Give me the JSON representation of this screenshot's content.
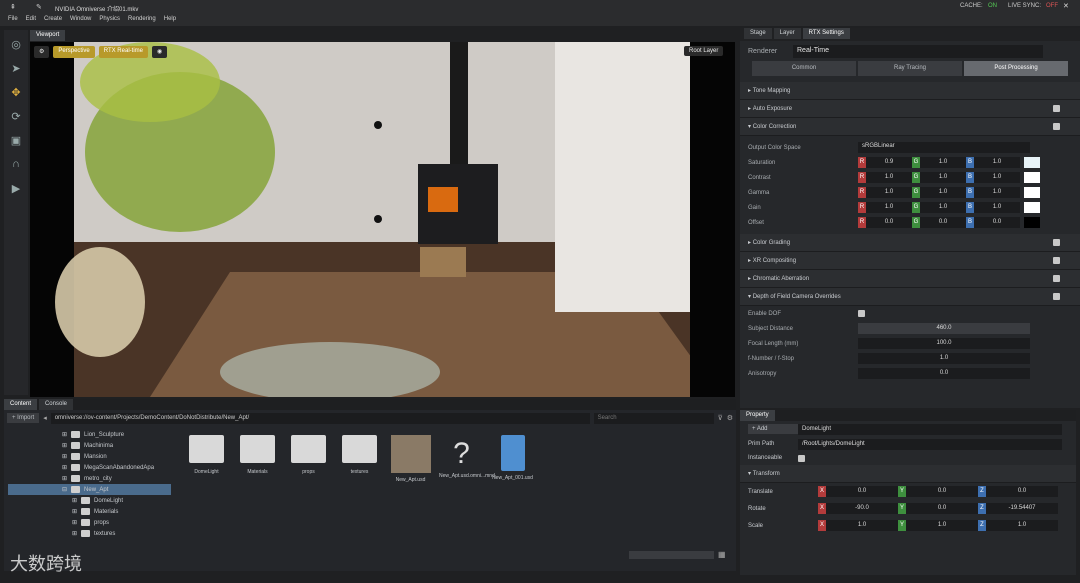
{
  "window": {
    "title": "NVIDIA Omniverse 介绍01.mkv",
    "cache": "CACHE:",
    "cache_state": "ON",
    "live_sync": "LIVE SYNC:",
    "live_state": "OFF"
  },
  "menu": [
    "File",
    "Edit",
    "Create",
    "Window",
    "Physics",
    "Rendering",
    "Help"
  ],
  "viewport": {
    "tab": "Viewport",
    "camera": "Perspective",
    "render": "RTX Real-time",
    "layer": "Root Layer"
  },
  "right_tabs": [
    "Stage",
    "Layer",
    "RTX Settings"
  ],
  "renderer": {
    "label": "Renderer",
    "value": "Real-Time",
    "tabs": [
      "Common",
      "Ray Tracing",
      "Post Processing"
    ]
  },
  "sections": [
    "Tone Mapping",
    "Auto Exposure",
    "Color Correction",
    "Color Grading",
    "XR Compositing",
    "Chromatic Aberration",
    "Depth of Field Camera Overrides"
  ],
  "color_correction": {
    "space_label": "Output Color Space",
    "space_value": "sRGBLinear",
    "rows": [
      {
        "label": "Saturation",
        "r": "0.9",
        "g": "1.0",
        "b": "1.0"
      },
      {
        "label": "Contrast",
        "r": "1.0",
        "g": "1.0",
        "b": "1.0"
      },
      {
        "label": "Gamma",
        "r": "1.0",
        "g": "1.0",
        "b": "1.0"
      },
      {
        "label": "Gain",
        "r": "1.0",
        "g": "1.0",
        "b": "1.0"
      },
      {
        "label": "Offset",
        "r": "0.0",
        "g": "0.0",
        "b": "0.0"
      }
    ]
  },
  "dof": {
    "rows": [
      {
        "label": "Enable DOF",
        "value": ""
      },
      {
        "label": "Subject Distance",
        "value": "460.0"
      },
      {
        "label": "Focal Length (mm)",
        "value": "100.0"
      },
      {
        "label": "f-Number / f-Stop",
        "value": "1.0"
      },
      {
        "label": "Anisotropy",
        "value": "0.0"
      }
    ]
  },
  "bottom_tabs": [
    "Content",
    "Console"
  ],
  "content": {
    "import": "Import",
    "path": "omniverse://ov-content/Projects/DemoContent/DoNotDistribute/New_Apt/",
    "search": "Search",
    "tree": [
      "Lion_Sculpture",
      "Machinima",
      "Mansion",
      "MegaScanAbandonedApa",
      "metro_city",
      "New_Apt",
      "DomeLight",
      "Materials",
      "props",
      "textures"
    ],
    "files": [
      "DomeLight",
      "Materials",
      "props",
      "textures",
      "New_Apt.usd",
      "New_Apt.usd.omni...mnd",
      "New_Apt_001.usd"
    ]
  },
  "property": {
    "tab": "Property",
    "add": "Add",
    "name": "DomeLight",
    "prim_label": "Prim Path",
    "prim_path": "/Root/Lights/DomeLight",
    "instanceable": "Instanceable",
    "transform": "Transform",
    "rows": [
      {
        "label": "Translate",
        "x": "0.0",
        "y": "0.0",
        "z": "0.0"
      },
      {
        "label": "Rotate",
        "x": "-90.0",
        "y": "0.0",
        "z": "-19.54407"
      },
      {
        "label": "Scale",
        "x": "1.0",
        "y": "1.0",
        "z": "1.0"
      }
    ]
  },
  "watermark": "大数跨境"
}
